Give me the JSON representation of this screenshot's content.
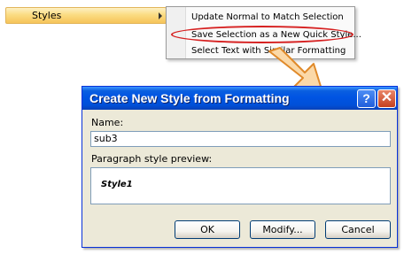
{
  "menu": {
    "styles_label": "Styles"
  },
  "submenu": {
    "items": [
      {
        "label": "Update Normal to Match Selection"
      },
      {
        "label": "Save Selection as a New Quick Style..."
      },
      {
        "label": "Select Text with Similar Formatting"
      }
    ]
  },
  "dialog": {
    "title": "Create New Style from Formatting",
    "help_glyph": "?",
    "close_glyph": "✕",
    "name_label": "Name:",
    "name_value": "sub3",
    "preview_label": "Paragraph style preview:",
    "preview_style": "Style1",
    "ok_label": "OK",
    "modify_label": "Modify...",
    "cancel_label": "Cancel"
  },
  "colors": {
    "highlight": "#d62020",
    "arrow_fill": "#fbd9a8",
    "titlebar": "#0054e3"
  }
}
